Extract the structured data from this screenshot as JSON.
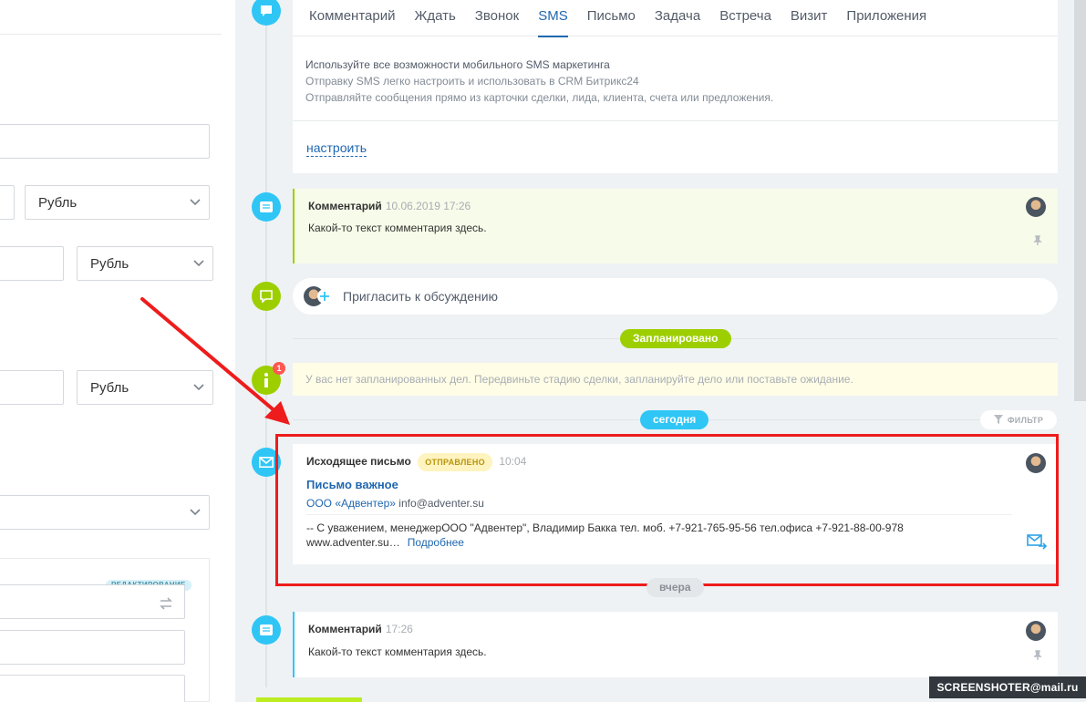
{
  "form": {
    "currency_1": "Рубль",
    "currency_2": "Рубль",
    "currency_3": "Рубль",
    "edit_badge": "РЕДАКТИРОВАНИЕ"
  },
  "editor": {
    "tabs": [
      {
        "label": "Комментарий",
        "active": false
      },
      {
        "label": "Ждать",
        "active": false
      },
      {
        "label": "Звонок",
        "active": false
      },
      {
        "label": "SMS",
        "active": true
      },
      {
        "label": "Письмо",
        "active": false
      },
      {
        "label": "Задача",
        "active": false
      },
      {
        "label": "Встреча",
        "active": false
      },
      {
        "label": "Визит",
        "active": false
      },
      {
        "label": "Приложения",
        "active": false
      }
    ],
    "sms_line1": "Используйте все возможности мобильного SMS маркетинга",
    "sms_line2": "Отправку SMS легко настроить и использовать в CRM Битрикс24",
    "sms_line3": "Отправляйте сообщения прямо из карточки сделки, лида, клиента, счета или предложения.",
    "setup_link": "настроить"
  },
  "comment1": {
    "title": "Комментарий",
    "time": "10.06.2019 17:26",
    "text": "Какой-то текст комментария здесь."
  },
  "invite": {
    "text": "Пригласить к обсуждению"
  },
  "planned": {
    "label": "Запланировано",
    "count": "1",
    "note": "У вас нет запланированных дел. Передвиньте стадию сделки, запланируйте дело или поставьте ожидание."
  },
  "today": {
    "label": "сегодня",
    "filter": "ФИЛЬТР"
  },
  "email": {
    "title": "Исходящее письмо",
    "status": "ОТПРАВЛЕНО",
    "time": "10:04",
    "subject": "Письмо важное",
    "company": "ООО «Адвентер»",
    "address": "info@adventer.su",
    "body_line1": "-- С уважением, менеджерООО \"Адвентер\", Владимир Бакка тел. моб. +7-921-765-95-56 тел.офиса +7-921-88-00-978",
    "body_line2": "www.adventer.su…",
    "more": "Подробнее"
  },
  "yesterday": {
    "label": "вчера"
  },
  "comment2": {
    "title": "Комментарий",
    "time": "17:26",
    "text": "Какой-то текст комментария здесь."
  },
  "watermark": "SCREENSHOTER@mail.ru",
  "colors": {
    "accent_blue": "#2fc6f6",
    "accent_green": "#9dcf00",
    "link": "#2067b0",
    "highlight": "#ee1c1c"
  }
}
